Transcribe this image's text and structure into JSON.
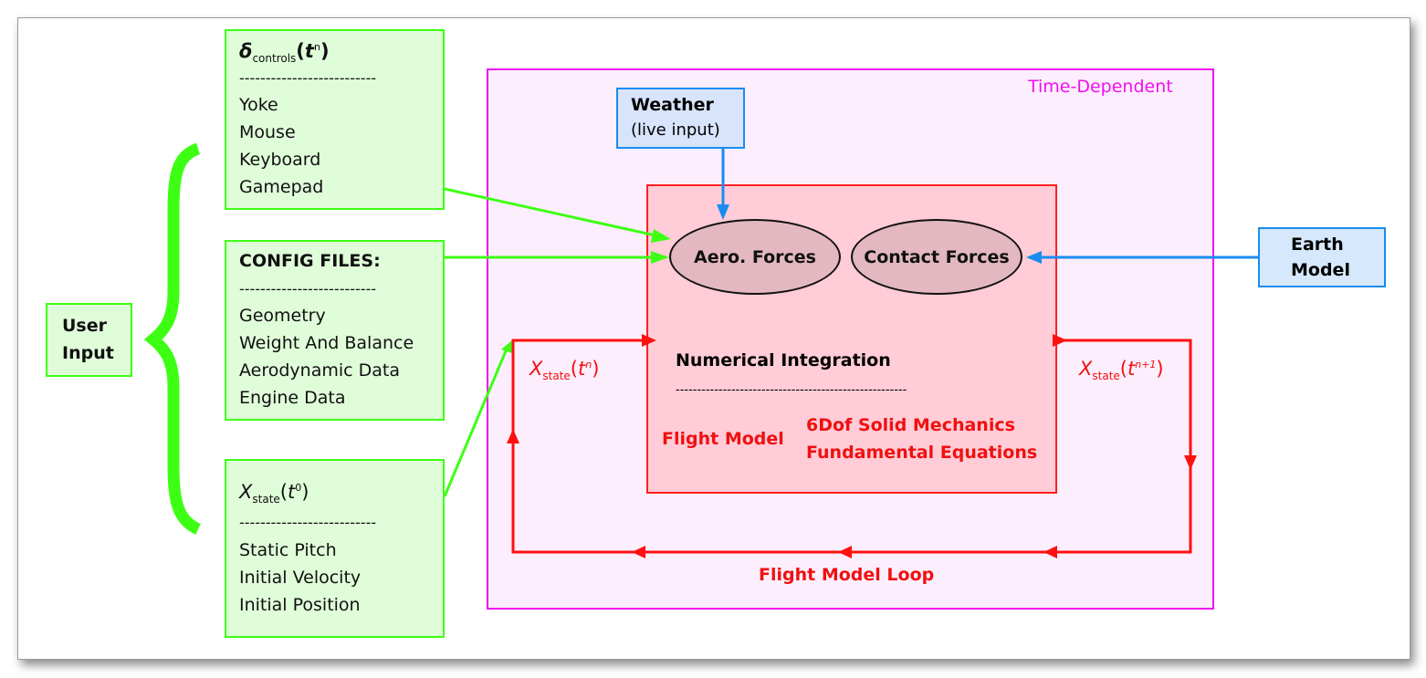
{
  "user_input": {
    "line1": "User",
    "line2": "Input"
  },
  "controls_box": {
    "title_symbol": "δ",
    "title_sub": "controls",
    "title_arg_open": "(",
    "title_t": "t",
    "title_sup": "n",
    "title_arg_close": ")",
    "separator": "--------------------------",
    "items": [
      "Yoke",
      "Mouse",
      "Keyboard",
      "Gamepad"
    ]
  },
  "config_box": {
    "title": "CONFIG FILES:",
    "separator": "--------------------------",
    "items": [
      "Geometry",
      "Weight And Balance",
      "Aerodynamic Data",
      "Engine Data"
    ]
  },
  "initial_state_box": {
    "title_symbol": "X",
    "title_sub": "state",
    "title_arg_open": "(",
    "title_t": "t",
    "title_sup": "0",
    "title_arg_close": ")",
    "separator": "--------------------------",
    "items": [
      "Static Pitch",
      "Initial Velocity",
      "Initial Position"
    ]
  },
  "time_dependent": {
    "label": "Time-Dependent"
  },
  "weather": {
    "line1": "Weather",
    "line2": "(live input)"
  },
  "earth_model": {
    "line1": "Earth",
    "line2": "Model"
  },
  "flight_model_box": {
    "aero_forces": "Aero. Forces",
    "contact_forces": "Contact Forces",
    "numerical_integration": "Numerical Integration",
    "separator": "------------------------------------------------------",
    "flight_model_label": "Flight Model",
    "equations_line1": "6Dof Solid Mechanics",
    "equations_line2": "Fundamental Equations"
  },
  "state_in": {
    "symbol": "X",
    "sub": "state",
    "open": "(",
    "t": "t",
    "sup": "n",
    "close": ")"
  },
  "state_out": {
    "symbol": "X",
    "sub": "state",
    "open": "(",
    "t": "t",
    "sup": "n+1",
    "close": ")"
  },
  "loop_label": "Flight Model Loop",
  "colors": {
    "user_input_green": "#3dff14",
    "user_input_fill": "#e0fdd9",
    "time_dependent_magenta": "#f010f0",
    "time_dependent_fill": "#fdeefd",
    "flight_model_red": "#ff2020",
    "flight_model_fill": "#ffccd7",
    "external_blue": "#1a8cf0",
    "ellipse_fill": "#e3b8c1"
  }
}
